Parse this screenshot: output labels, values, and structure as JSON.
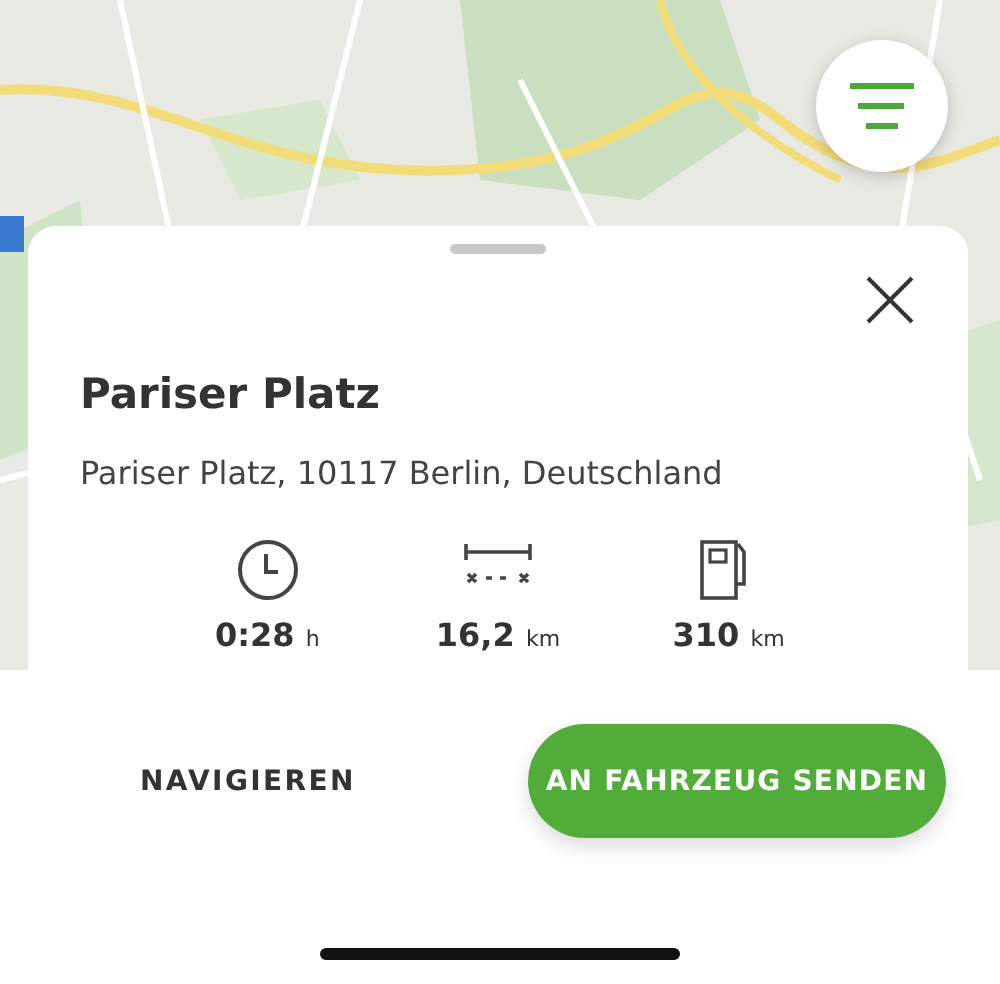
{
  "destination": {
    "title": "Pariser Platz",
    "address": "Pariser Platz, 10117 Berlin, Deutschland"
  },
  "stats": [
    {
      "kind": "duration",
      "value": "0:28",
      "unit": "h"
    },
    {
      "kind": "distance",
      "value": "16,2",
      "unit": "km"
    },
    {
      "kind": "range",
      "value": "310",
      "unit": "km"
    }
  ],
  "actions": [
    {
      "kind": "text",
      "label": "NAVIGIEREN"
    },
    {
      "kind": "primary",
      "label": "AN FAHRZEUG SENDEN"
    }
  ]
}
